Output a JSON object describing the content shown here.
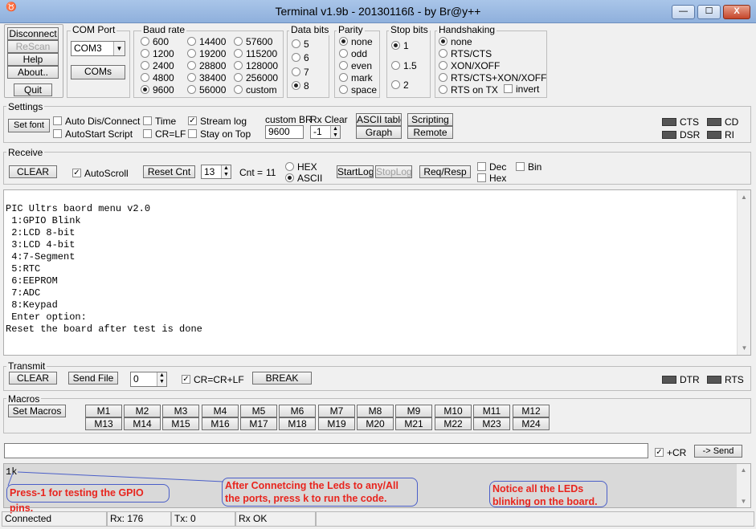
{
  "window": {
    "title": "Terminal v1.9b - 20130116ß - by Br@y++",
    "app_icon": "♉",
    "minimize": "—",
    "maximize": "☐",
    "close": "X"
  },
  "top_buttons": {
    "disconnect": "Disconnect",
    "rescan": "ReScan",
    "help": "Help",
    "about": "About..",
    "quit": "Quit"
  },
  "com_port": {
    "label": "COM Port",
    "value": "COM3",
    "coms_button": "COMs"
  },
  "baud_rate": {
    "label": "Baud rate",
    "options": [
      "600",
      "1200",
      "2400",
      "4800",
      "9600",
      "14400",
      "19200",
      "28800",
      "38400",
      "56000",
      "57600",
      "115200",
      "128000",
      "256000",
      "custom"
    ],
    "selected": "9600"
  },
  "data_bits": {
    "label": "Data bits",
    "options": [
      "5",
      "6",
      "7",
      "8"
    ],
    "selected": "8"
  },
  "parity": {
    "label": "Parity",
    "options": [
      "none",
      "odd",
      "even",
      "mark",
      "space"
    ],
    "selected": "none"
  },
  "stop_bits": {
    "label": "Stop bits",
    "options": [
      "1",
      "1.5",
      "2"
    ],
    "selected": "1"
  },
  "handshaking": {
    "label": "Handshaking",
    "options": [
      "none",
      "RTS/CTS",
      "XON/XOFF",
      "RTS/CTS+XON/XOFF",
      "RTS on TX"
    ],
    "selected": "none",
    "invert": "invert"
  },
  "settings": {
    "label": "Settings",
    "set_font": "Set font",
    "auto_dis_connect": "Auto Dis/Connect",
    "autostart_script": "AutoStart Script",
    "time": "Time",
    "cr_lf": "CR=LF",
    "stream_log": "Stream log",
    "stay_on_top": "Stay on Top",
    "custom_br_label": "custom BR",
    "custom_br_value": "9600",
    "rx_clear_label": "Rx Clear",
    "rx_clear_value": "-1",
    "ascii_table": "ASCII table",
    "scripting": "Scripting",
    "graph": "Graph",
    "remote": "Remote"
  },
  "indicators": {
    "cts": "CTS",
    "cd": "CD",
    "dsr": "DSR",
    "ri": "RI",
    "dtr": "DTR",
    "rts": "RTS"
  },
  "receive": {
    "label": "Receive",
    "clear": "CLEAR",
    "autoscroll": "AutoScroll",
    "reset_cnt": "Reset Cnt",
    "cnt_spin": "13",
    "cnt_label": "Cnt =",
    "cnt_value": "11",
    "hex": "HEX",
    "ascii": "ASCII",
    "startlog": "StartLog",
    "stoplog": "StopLog",
    "req_resp": "Req/Resp",
    "dec": "Dec",
    "hex_chk": "Hex",
    "bin": "Bin"
  },
  "terminal_lines": [
    "PIC Ultrs baord menu v2.0",
    " 1:GPIO Blink",
    " 2:LCD 8-bit",
    " 3:LCD 4-bit",
    " 4:7-Segment",
    " 5:RTC",
    " 6:EEPROM",
    " 7:ADC",
    " 8:Keypad",
    " Enter option:",
    "Reset the board after test is done"
  ],
  "transmit": {
    "label": "Transmit",
    "clear": "CLEAR",
    "send_file": "Send File",
    "spin_value": "0",
    "cr_crlf": "CR=CR+LF",
    "break": "BREAK"
  },
  "macros": {
    "label": "Macros",
    "set_macros": "Set Macros",
    "row1": [
      "M1",
      "M2",
      "M3",
      "M4",
      "M5",
      "M6",
      "M7",
      "M8",
      "M9",
      "M10",
      "M11",
      "M12"
    ],
    "row2": [
      "M13",
      "M14",
      "M15",
      "M16",
      "M17",
      "M18",
      "M19",
      "M20",
      "M21",
      "M22",
      "M23",
      "M24"
    ]
  },
  "send_bar": {
    "input_value": "",
    "plus_cr": "+CR",
    "send": "-> Send"
  },
  "transmit_log": {
    "text": "1k"
  },
  "annotations": [
    "Press-1 for testing the GPIO pins.",
    "After Connetcing the Leds to any/All the ports, press k to run the code.",
    "Notice all the LEDs blinking on the board."
  ],
  "status_bar": {
    "connection": "Connected",
    "rx": "Rx: 176",
    "tx": "Tx: 0",
    "rx_ok": "Rx OK"
  },
  "colors": {
    "annotation_text": "#e8251e",
    "annotation_border": "#4a5ec8",
    "titlebar": "#9cbbe3"
  }
}
